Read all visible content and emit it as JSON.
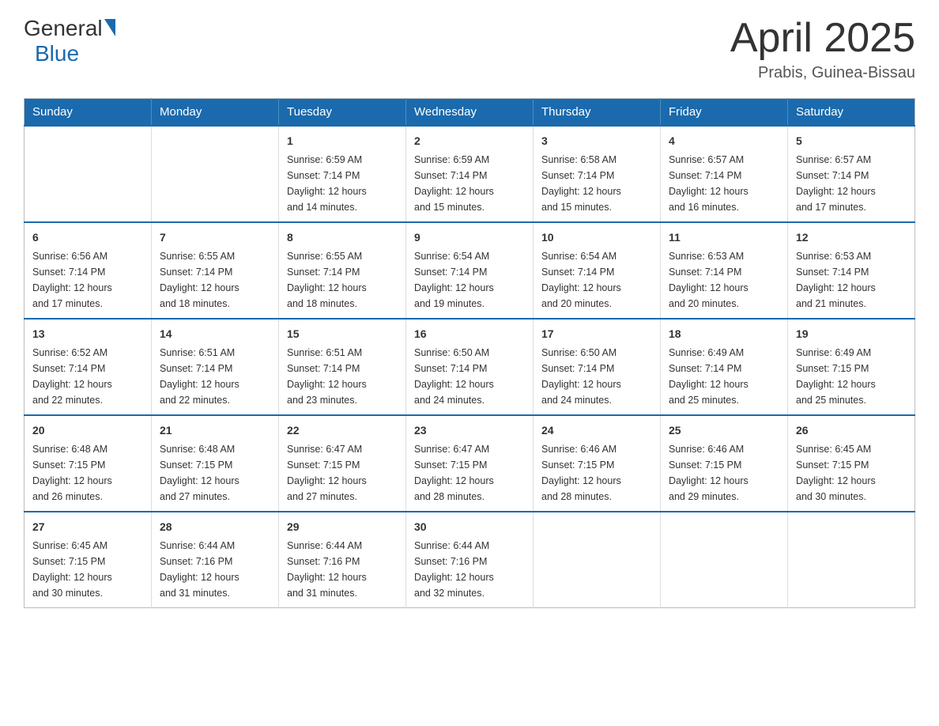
{
  "header": {
    "logo_general": "General",
    "logo_blue": "Blue",
    "title": "April 2025",
    "subtitle": "Prabis, Guinea-Bissau"
  },
  "calendar": {
    "days_of_week": [
      "Sunday",
      "Monday",
      "Tuesday",
      "Wednesday",
      "Thursday",
      "Friday",
      "Saturday"
    ],
    "weeks": [
      [
        {
          "day": "",
          "info": []
        },
        {
          "day": "",
          "info": []
        },
        {
          "day": "1",
          "info": [
            "Sunrise: 6:59 AM",
            "Sunset: 7:14 PM",
            "Daylight: 12 hours",
            "and 14 minutes."
          ]
        },
        {
          "day": "2",
          "info": [
            "Sunrise: 6:59 AM",
            "Sunset: 7:14 PM",
            "Daylight: 12 hours",
            "and 15 minutes."
          ]
        },
        {
          "day": "3",
          "info": [
            "Sunrise: 6:58 AM",
            "Sunset: 7:14 PM",
            "Daylight: 12 hours",
            "and 15 minutes."
          ]
        },
        {
          "day": "4",
          "info": [
            "Sunrise: 6:57 AM",
            "Sunset: 7:14 PM",
            "Daylight: 12 hours",
            "and 16 minutes."
          ]
        },
        {
          "day": "5",
          "info": [
            "Sunrise: 6:57 AM",
            "Sunset: 7:14 PM",
            "Daylight: 12 hours",
            "and 17 minutes."
          ]
        }
      ],
      [
        {
          "day": "6",
          "info": [
            "Sunrise: 6:56 AM",
            "Sunset: 7:14 PM",
            "Daylight: 12 hours",
            "and 17 minutes."
          ]
        },
        {
          "day": "7",
          "info": [
            "Sunrise: 6:55 AM",
            "Sunset: 7:14 PM",
            "Daylight: 12 hours",
            "and 18 minutes."
          ]
        },
        {
          "day": "8",
          "info": [
            "Sunrise: 6:55 AM",
            "Sunset: 7:14 PM",
            "Daylight: 12 hours",
            "and 18 minutes."
          ]
        },
        {
          "day": "9",
          "info": [
            "Sunrise: 6:54 AM",
            "Sunset: 7:14 PM",
            "Daylight: 12 hours",
            "and 19 minutes."
          ]
        },
        {
          "day": "10",
          "info": [
            "Sunrise: 6:54 AM",
            "Sunset: 7:14 PM",
            "Daylight: 12 hours",
            "and 20 minutes."
          ]
        },
        {
          "day": "11",
          "info": [
            "Sunrise: 6:53 AM",
            "Sunset: 7:14 PM",
            "Daylight: 12 hours",
            "and 20 minutes."
          ]
        },
        {
          "day": "12",
          "info": [
            "Sunrise: 6:53 AM",
            "Sunset: 7:14 PM",
            "Daylight: 12 hours",
            "and 21 minutes."
          ]
        }
      ],
      [
        {
          "day": "13",
          "info": [
            "Sunrise: 6:52 AM",
            "Sunset: 7:14 PM",
            "Daylight: 12 hours",
            "and 22 minutes."
          ]
        },
        {
          "day": "14",
          "info": [
            "Sunrise: 6:51 AM",
            "Sunset: 7:14 PM",
            "Daylight: 12 hours",
            "and 22 minutes."
          ]
        },
        {
          "day": "15",
          "info": [
            "Sunrise: 6:51 AM",
            "Sunset: 7:14 PM",
            "Daylight: 12 hours",
            "and 23 minutes."
          ]
        },
        {
          "day": "16",
          "info": [
            "Sunrise: 6:50 AM",
            "Sunset: 7:14 PM",
            "Daylight: 12 hours",
            "and 24 minutes."
          ]
        },
        {
          "day": "17",
          "info": [
            "Sunrise: 6:50 AM",
            "Sunset: 7:14 PM",
            "Daylight: 12 hours",
            "and 24 minutes."
          ]
        },
        {
          "day": "18",
          "info": [
            "Sunrise: 6:49 AM",
            "Sunset: 7:14 PM",
            "Daylight: 12 hours",
            "and 25 minutes."
          ]
        },
        {
          "day": "19",
          "info": [
            "Sunrise: 6:49 AM",
            "Sunset: 7:15 PM",
            "Daylight: 12 hours",
            "and 25 minutes."
          ]
        }
      ],
      [
        {
          "day": "20",
          "info": [
            "Sunrise: 6:48 AM",
            "Sunset: 7:15 PM",
            "Daylight: 12 hours",
            "and 26 minutes."
          ]
        },
        {
          "day": "21",
          "info": [
            "Sunrise: 6:48 AM",
            "Sunset: 7:15 PM",
            "Daylight: 12 hours",
            "and 27 minutes."
          ]
        },
        {
          "day": "22",
          "info": [
            "Sunrise: 6:47 AM",
            "Sunset: 7:15 PM",
            "Daylight: 12 hours",
            "and 27 minutes."
          ]
        },
        {
          "day": "23",
          "info": [
            "Sunrise: 6:47 AM",
            "Sunset: 7:15 PM",
            "Daylight: 12 hours",
            "and 28 minutes."
          ]
        },
        {
          "day": "24",
          "info": [
            "Sunrise: 6:46 AM",
            "Sunset: 7:15 PM",
            "Daylight: 12 hours",
            "and 28 minutes."
          ]
        },
        {
          "day": "25",
          "info": [
            "Sunrise: 6:46 AM",
            "Sunset: 7:15 PM",
            "Daylight: 12 hours",
            "and 29 minutes."
          ]
        },
        {
          "day": "26",
          "info": [
            "Sunrise: 6:45 AM",
            "Sunset: 7:15 PM",
            "Daylight: 12 hours",
            "and 30 minutes."
          ]
        }
      ],
      [
        {
          "day": "27",
          "info": [
            "Sunrise: 6:45 AM",
            "Sunset: 7:15 PM",
            "Daylight: 12 hours",
            "and 30 minutes."
          ]
        },
        {
          "day": "28",
          "info": [
            "Sunrise: 6:44 AM",
            "Sunset: 7:16 PM",
            "Daylight: 12 hours",
            "and 31 minutes."
          ]
        },
        {
          "day": "29",
          "info": [
            "Sunrise: 6:44 AM",
            "Sunset: 7:16 PM",
            "Daylight: 12 hours",
            "and 31 minutes."
          ]
        },
        {
          "day": "30",
          "info": [
            "Sunrise: 6:44 AM",
            "Sunset: 7:16 PM",
            "Daylight: 12 hours",
            "and 32 minutes."
          ]
        },
        {
          "day": "",
          "info": []
        },
        {
          "day": "",
          "info": []
        },
        {
          "day": "",
          "info": []
        }
      ]
    ]
  }
}
